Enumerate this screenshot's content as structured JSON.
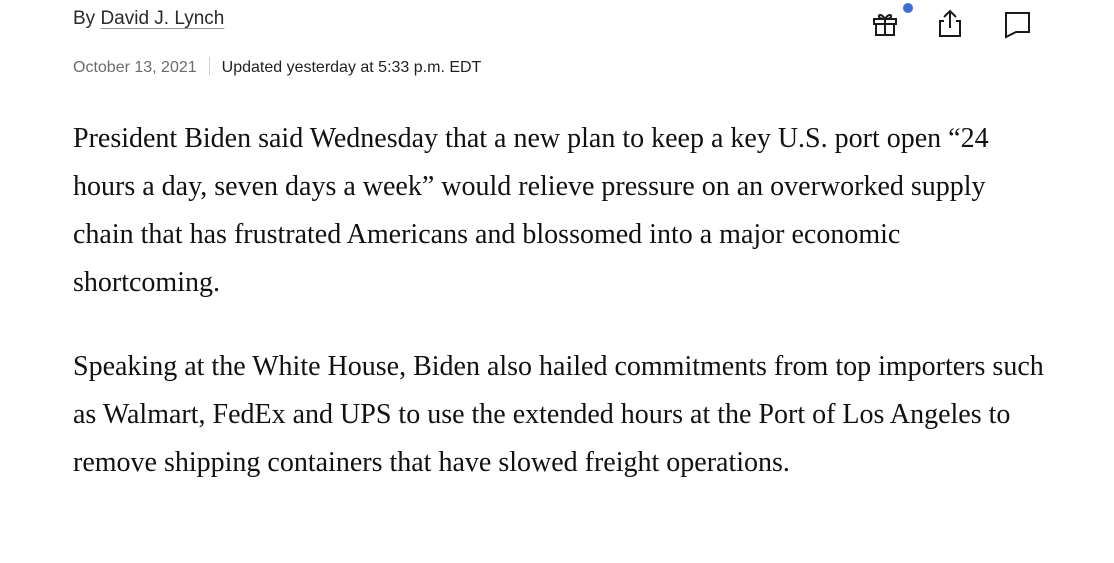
{
  "byline": {
    "prefix": "By ",
    "author": "David J. Lynch"
  },
  "dateline": {
    "published": "October 13, 2021",
    "updated": "Updated yesterday at 5:33 p.m. EDT"
  },
  "toolbar": {
    "gift_icon": "gift-icon",
    "share_icon": "share-icon",
    "comment_icon": "comment-icon",
    "notification_color": "#3a6fd8"
  },
  "article": {
    "p1_before": "President Biden said Wednesday that ",
    "p1_highlight": "a new plan to keep a key U.S. port open “24 hours a day, seven days a week”",
    "p1_after": " would relieve pressure on an overworked supply chain that has frustrated Americans and blossomed into a major economic shortcoming.",
    "p2": "Speaking at the White House, Biden also hailed commitments from top importers such as Walmart, FedEx and UPS to use the extended hours at the Port of Los Angeles to remove shipping containers that have slowed freight operations.",
    "highlight_color": "#e0141b"
  }
}
